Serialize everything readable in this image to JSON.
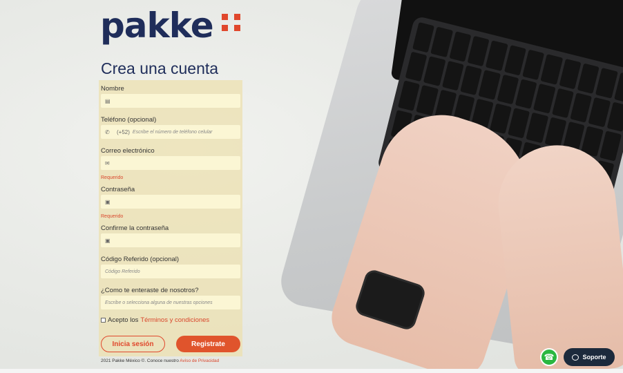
{
  "brand": {
    "logo_text": "pakke",
    "accent_color": "#e0472c",
    "brand_color": "#1f2d5a"
  },
  "title": "Crea una cuenta",
  "form": {
    "name_label": "Nombre",
    "phone_label": "Teléfono (opcional)",
    "phone_prefix": "(+52)",
    "phone_placeholder": "Escribe el número de teléfono celular",
    "email_label": "Correo electrónico",
    "email_required": "Requerido",
    "password_label": "Contraseña",
    "password_required": "Requerido",
    "confirm_label": "Confirme la contraseña",
    "referral_label": "Código Referido (opcional)",
    "referral_placeholder": "Código Referido",
    "source_label": "¿Como te enteraste de nosotros?",
    "source_placeholder": "Escribe o selecciona alguna de nuestras opciones",
    "terms_text": "Acepto los",
    "terms_link": "Términos y condiciones",
    "login_button": "Inicia sesión",
    "register_button": "Registrate"
  },
  "footer": {
    "text": "2021 Pakke México ©. Conoce nuestro",
    "privacy_link": "Aviso de Privacidad"
  },
  "support_label": "Soporte",
  "icons": {
    "name": "id-card-icon",
    "phone": "phone-icon",
    "email": "envelope-icon",
    "password": "lock-icon",
    "whatsapp": "whatsapp-icon",
    "support": "chat-bubble-icon"
  }
}
